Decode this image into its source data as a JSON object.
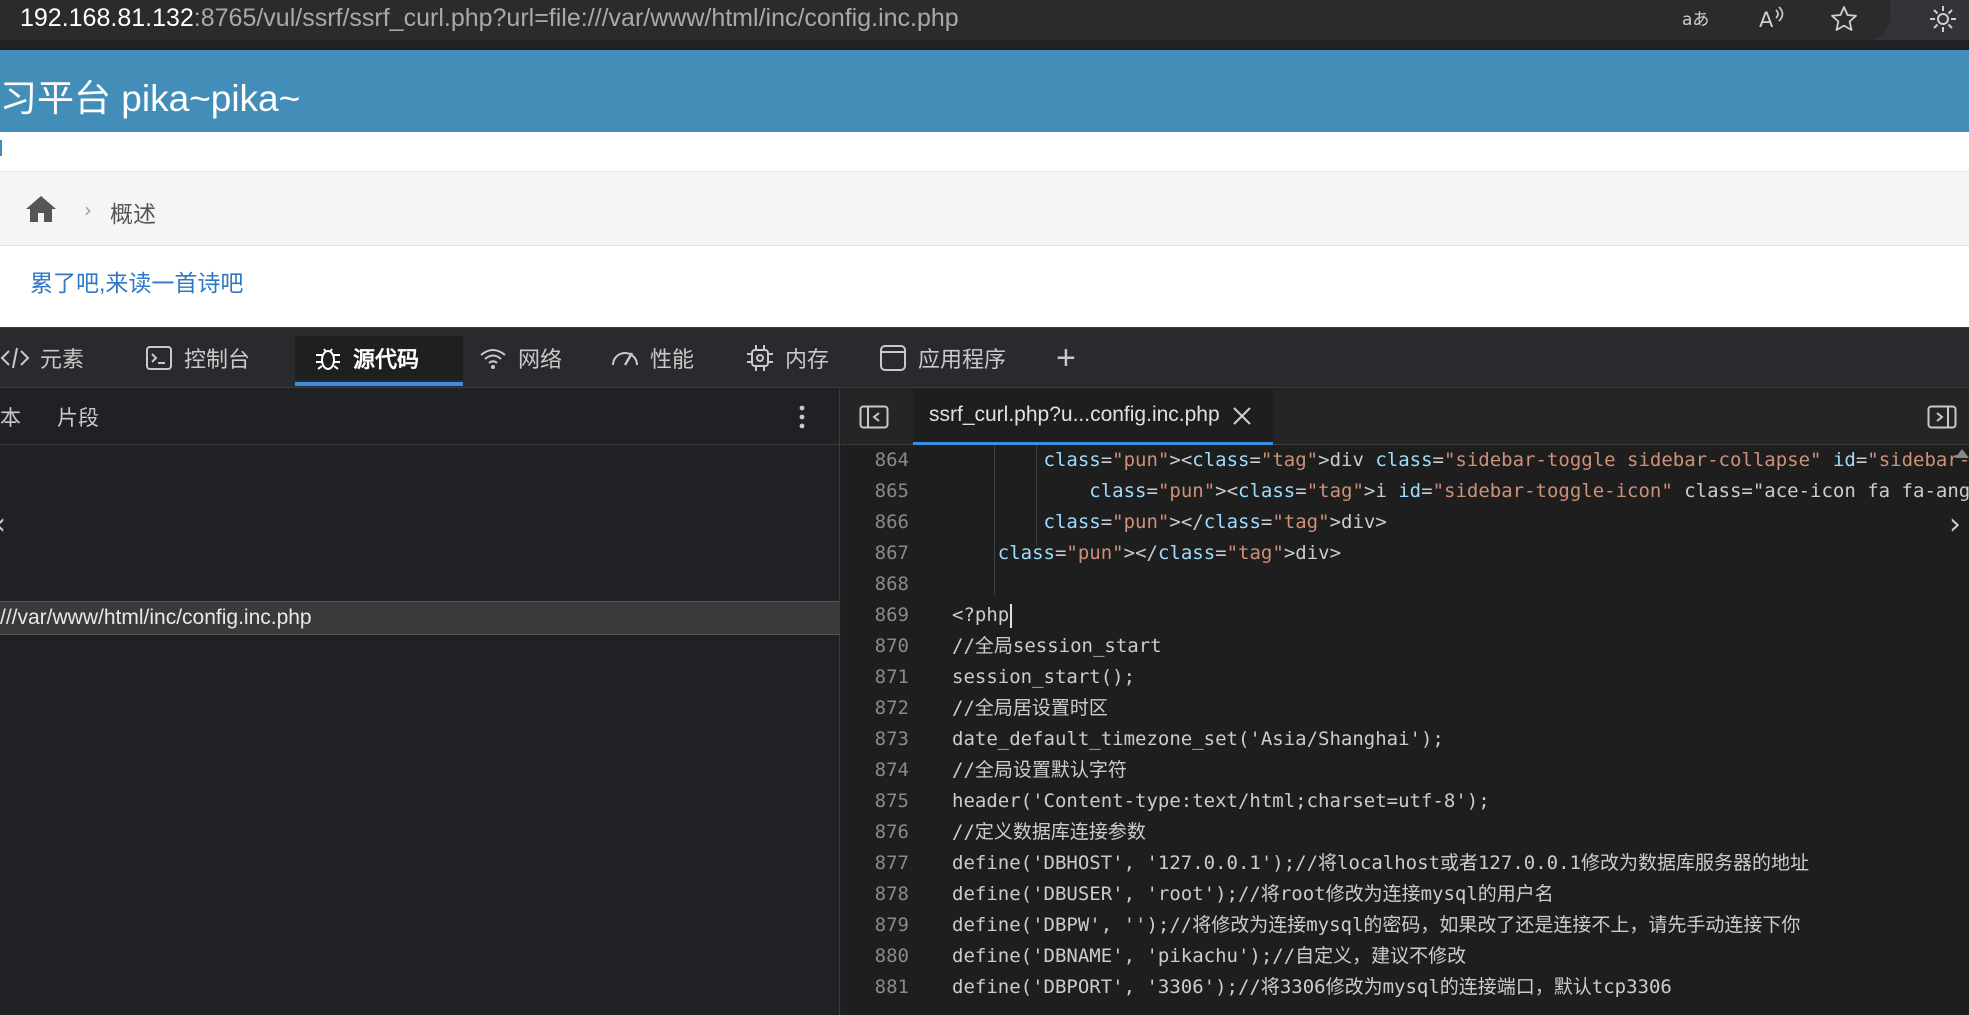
{
  "browser": {
    "url_host": "192.168.81.132",
    "url_rest": ":8765/vul/ssrf/ssrf_curl.php?url=file:///var/www/html/inc/config.inc.php",
    "icons": [
      "read-aloud-translate-icon",
      "read-aloud-icon",
      "favorite-star-icon",
      "settings-extension-icon"
    ]
  },
  "page": {
    "title": "习平台 pika~pika~",
    "breadcrumb": {
      "home_icon": "home-icon",
      "separator": "›",
      "label": "概述"
    },
    "poem_link": "累了吧,来读一首诗吧"
  },
  "devtools": {
    "tabs": [
      {
        "label": "元素",
        "icon": "code-brackets-icon"
      },
      {
        "label": "控制台",
        "icon": "console-icon"
      },
      {
        "label": "源代码",
        "icon": "bug-icon",
        "active": true
      },
      {
        "label": "网络",
        "icon": "wifi-icon"
      },
      {
        "label": "性能",
        "icon": "gauge-icon"
      },
      {
        "label": "内存",
        "icon": "chip-icon"
      },
      {
        "label": "应用程序",
        "icon": "app-window-icon"
      }
    ],
    "add_tab_label": "+",
    "navigator": {
      "tabs": [
        "本",
        "片段"
      ],
      "chevron": "‹",
      "selected_file": "///var/www/html/inc/config.inc.php"
    },
    "editor": {
      "file_tab": "ssrf_curl.php?u...config.inc.php",
      "lines": [
        {
          "n": "864",
          "text": "        <div class=\"sidebar-toggle sidebar-collapse\" id=\"sidebar-collapse\">"
        },
        {
          "n": "865",
          "text": "            <i id=\"sidebar-toggle-icon\" class=\"ace-icon fa fa-angle-double-left ac"
        },
        {
          "n": "866",
          "text": "        </div>"
        },
        {
          "n": "867",
          "text": "    </div>"
        },
        {
          "n": "868",
          "text": ""
        },
        {
          "n": "869",
          "text": "<?php"
        },
        {
          "n": "870",
          "text": "//全局session_start"
        },
        {
          "n": "871",
          "text": "session_start();"
        },
        {
          "n": "872",
          "text": "//全局居设置时区"
        },
        {
          "n": "873",
          "text": "date_default_timezone_set('Asia/Shanghai');"
        },
        {
          "n": "874",
          "text": "//全局设置默认字符"
        },
        {
          "n": "875",
          "text": "header('Content-type:text/html;charset=utf-8');"
        },
        {
          "n": "876",
          "text": "//定义数据库连接参数"
        },
        {
          "n": "877",
          "text": "define('DBHOST', '127.0.0.1');//将localhost或者127.0.0.1修改为数据库服务器的地址"
        },
        {
          "n": "878",
          "text": "define('DBUSER', 'root');//将root修改为连接mysql的用户名"
        },
        {
          "n": "879",
          "text": "define('DBPW', '');//将修改为连接mysql的密码，如果改了还是连接不上，请先手动连接下你"
        },
        {
          "n": "880",
          "text": "define('DBNAME', 'pikachu');//自定义，建议不修改"
        },
        {
          "n": "881",
          "text": "define('DBPORT', '3306');//将3306修改为mysql的连接端口，默认tcp3306"
        }
      ]
    }
  },
  "colors": {
    "header_blue": "#438eb9",
    "link_blue": "#2e78c5",
    "active_tab_underline": "#3b8fe0",
    "html_tag": "#5b9bd5",
    "html_attr": "#9cdcfe",
    "html_string": "#ce9178"
  }
}
